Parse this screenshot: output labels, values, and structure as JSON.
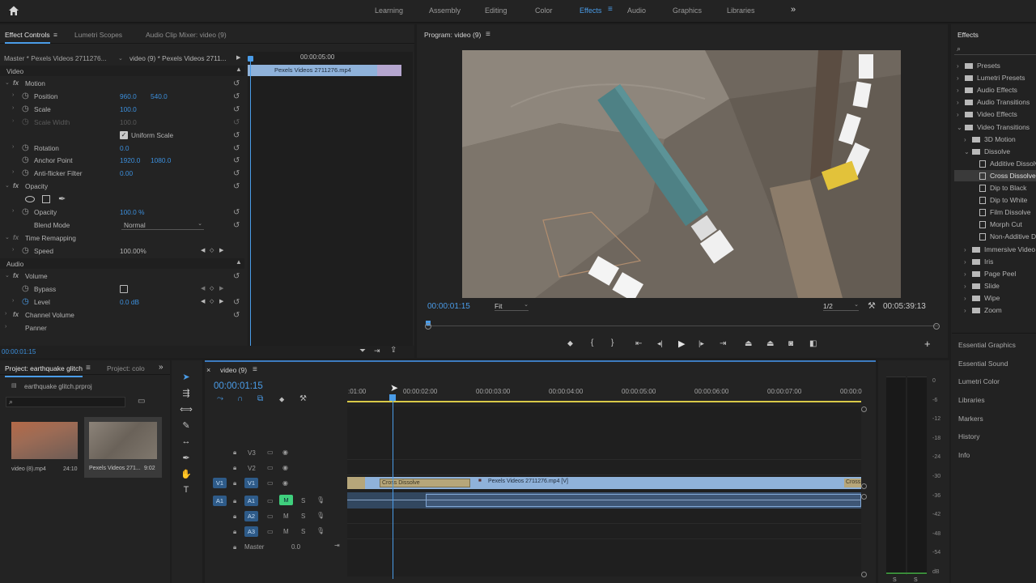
{
  "workspace": {
    "tabs": [
      "Learning",
      "Assembly",
      "Editing",
      "Color",
      "Effects",
      "Audio",
      "Graphics",
      "Libraries"
    ],
    "active": "Effects",
    "overflow": "»"
  },
  "effect_controls": {
    "tabs": [
      "Effect Controls",
      "Lumetri Scopes",
      "Audio Clip Mixer: video (9)"
    ],
    "source": "Master * Pexels Videos 2711276...",
    "target": "video (9) * Pexels Videos 2711...",
    "mini_timecode": "00:00:05:00",
    "clip_name": "Pexels Videos 2711276.mp4",
    "video_label": "Video",
    "motion": "Motion",
    "position_label": "Position",
    "position_x": "960.0",
    "position_y": "540.0",
    "scale_label": "Scale",
    "scale_value": "100.0",
    "scale_width_label": "Scale Width",
    "scale_width_value": "100.0",
    "uniform_scale": "Uniform Scale",
    "rotation_label": "Rotation",
    "rotation_value": "0.0",
    "anchor_label": "Anchor Point",
    "anchor_x": "1920.0",
    "anchor_y": "1080.0",
    "antiflicker_label": "Anti-flicker Filter",
    "antiflicker_value": "0.00",
    "opacity_section": "Opacity",
    "opacity_label": "Opacity",
    "opacity_value": "100.0 %",
    "blend_label": "Blend Mode",
    "blend_value": "Normal",
    "time_remap": "Time Remapping",
    "speed_label": "Speed",
    "speed_value": "100.00%",
    "audio_label": "Audio",
    "volume": "Volume",
    "bypass_label": "Bypass",
    "level_label": "Level",
    "level_value": "0.0 dB",
    "channel_volume": "Channel Volume",
    "panner": "Panner",
    "footer_timecode": "00:00:01:15"
  },
  "program": {
    "title": "Program: video (9)",
    "timecode": "00:00:01:15",
    "fit": "Fit",
    "resolution": "1/2",
    "duration": "00:05:39:13"
  },
  "effects_panel": {
    "title": "Effects",
    "items": [
      {
        "label": "Presets",
        "kind": "folder",
        "indent": 0,
        "arrow": "›"
      },
      {
        "label": "Lumetri Presets",
        "kind": "folder",
        "indent": 0,
        "arrow": "›"
      },
      {
        "label": "Audio Effects",
        "kind": "folder",
        "indent": 0,
        "arrow": "›"
      },
      {
        "label": "Audio Transitions",
        "kind": "folder",
        "indent": 0,
        "arrow": "›"
      },
      {
        "label": "Video Effects",
        "kind": "folder",
        "indent": 0,
        "arrow": "›"
      },
      {
        "label": "Video Transitions",
        "kind": "folder",
        "indent": 0,
        "arrow": "⌄"
      },
      {
        "label": "3D Motion",
        "kind": "folder",
        "indent": 1,
        "arrow": "›"
      },
      {
        "label": "Dissolve",
        "kind": "folder",
        "indent": 1,
        "arrow": "⌄"
      },
      {
        "label": "Additive Dissolve",
        "kind": "preset",
        "indent": 2,
        "arrow": ""
      },
      {
        "label": "Cross Dissolve",
        "kind": "preset",
        "indent": 2,
        "arrow": "",
        "selected": true
      },
      {
        "label": "Dip to Black",
        "kind": "preset",
        "indent": 2,
        "arrow": ""
      },
      {
        "label": "Dip to White",
        "kind": "preset",
        "indent": 2,
        "arrow": ""
      },
      {
        "label": "Film Dissolve",
        "kind": "preset",
        "indent": 2,
        "arrow": ""
      },
      {
        "label": "Morph Cut",
        "kind": "preset",
        "indent": 2,
        "arrow": ""
      },
      {
        "label": "Non-Additive Dissolve",
        "kind": "preset",
        "indent": 2,
        "arrow": ""
      },
      {
        "label": "Immersive Video",
        "kind": "folder",
        "indent": 1,
        "arrow": "›"
      },
      {
        "label": "Iris",
        "kind": "folder",
        "indent": 1,
        "arrow": "›"
      },
      {
        "label": "Page Peel",
        "kind": "folder",
        "indent": 1,
        "arrow": "›"
      },
      {
        "label": "Slide",
        "kind": "folder",
        "indent": 1,
        "arrow": "›"
      },
      {
        "label": "Wipe",
        "kind": "folder",
        "indent": 1,
        "arrow": "›"
      },
      {
        "label": "Zoom",
        "kind": "folder",
        "indent": 1,
        "arrow": "›"
      }
    ],
    "side_panels": [
      "Essential Graphics",
      "Essential Sound",
      "Lumetri Color",
      "Libraries",
      "Markers",
      "History",
      "Info"
    ]
  },
  "project": {
    "tabs": [
      "Project: earthquake glitch",
      "Project: colo"
    ],
    "file": "earthquake glitch.prproj",
    "clips": [
      {
        "name": "video (8).mp4",
        "duration": "24:10"
      },
      {
        "name": "Pexels Videos 271...",
        "duration": "9:02"
      }
    ]
  },
  "timeline": {
    "title": "video (9)",
    "timecode": "00:00:01:15",
    "ruler": [
      ":01:00",
      "00:00:02:00",
      "00:00:03:00",
      "00:00:04:00",
      "00:00:05:00",
      "00:00:06:00",
      "00:00:07:00",
      "00:00:0"
    ],
    "tracks_video": [
      "V3",
      "V2",
      "V1"
    ],
    "tracks_audio": [
      "A1",
      "A2",
      "A3"
    ],
    "source_v": "V1",
    "source_a": "A1",
    "master_label": "Master",
    "master_value": "0.0",
    "transition_label": "Cross Dissolve",
    "clip_label": "Pexels Videos 2711276.mp4 [V]",
    "transition_end": "Cross",
    "m_label": "M",
    "s_label": "S"
  },
  "meters": {
    "scale": [
      "0",
      "-6",
      "-12",
      "-18",
      "-24",
      "-30",
      "-36",
      "-42",
      "-48",
      "-54",
      "dB"
    ],
    "footer": [
      "S",
      "S"
    ]
  }
}
